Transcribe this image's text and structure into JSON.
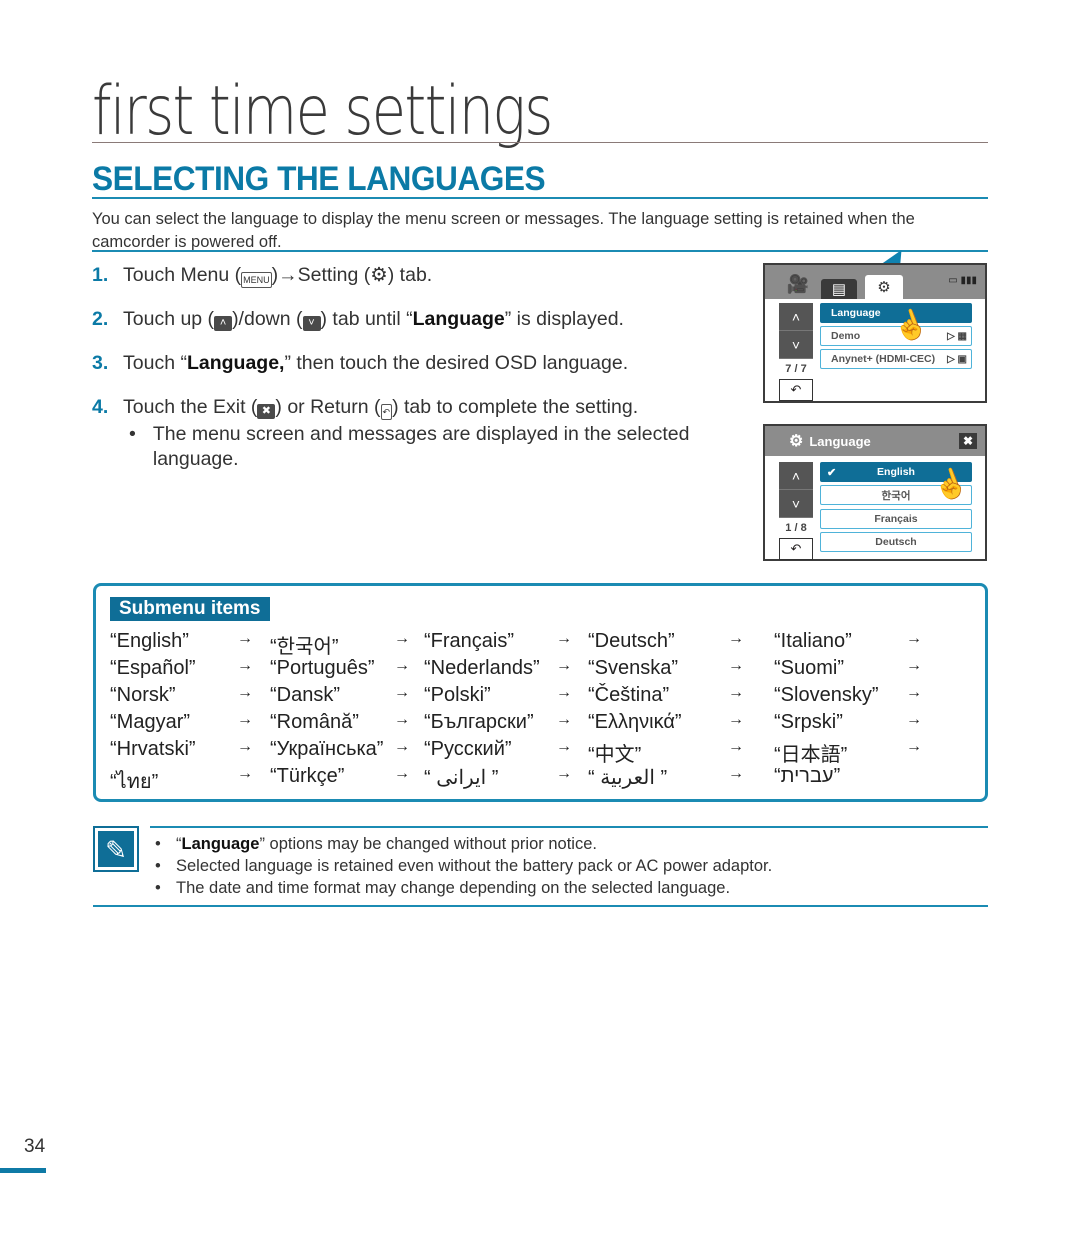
{
  "header": {
    "chapter_title": "first time settings",
    "section_title": "SELECTING THE LANGUAGES",
    "intro": "You can select the language to display the menu screen or messages. The language setting is retained when the camcorder is powered off."
  },
  "steps": [
    {
      "num": "1.",
      "parts": [
        "Touch Menu (",
        "MENU",
        ")→Setting (",
        "⚙",
        ") tab."
      ]
    },
    {
      "num": "2.",
      "parts": [
        "Touch up (",
        "˄",
        ")/down (",
        "˅",
        ") tab until “",
        "Language",
        "” is displayed."
      ]
    },
    {
      "num": "3.",
      "parts": [
        "Touch “",
        "Language,",
        "” then touch the desired OSD language."
      ]
    },
    {
      "num": "4.",
      "parts": [
        "Touch the Exit (",
        "✖",
        ") or Return (",
        "↶",
        ") tab to complete the setting."
      ]
    }
  ],
  "step_bullet": "The menu screen and messages are displayed in the selected language.",
  "screen1": {
    "status": "▭ ▮▮▮",
    "menu_items": [
      {
        "label": "Language",
        "selected": true,
        "right": ""
      },
      {
        "label": "Demo",
        "selected": false,
        "right": "▷ ▦"
      },
      {
        "label": "Anynet+ (HDMI-CEC)",
        "selected": false,
        "right": "▷ ▣"
      }
    ],
    "page_indicator": "7 / 7"
  },
  "screen2": {
    "title": "Language",
    "menu_items": [
      {
        "label": "English",
        "selected": true
      },
      {
        "label": "한국어",
        "selected": false
      },
      {
        "label": "Français",
        "selected": false
      },
      {
        "label": "Deutsch",
        "selected": false
      }
    ],
    "page_indicator": "1 / 8"
  },
  "submenu": {
    "label": "Submenu items",
    "rows": [
      [
        "“English”",
        "“한국어”",
        "“Français”",
        "“Deutsch”",
        "“Italiano”"
      ],
      [
        "“Español”",
        "“Português”",
        "“Nederlands”",
        "“Svenska”",
        "“Suomi”"
      ],
      [
        "“Norsk”",
        "“Dansk”",
        "“Polski”",
        "“Čeština”",
        "“Slovensky”"
      ],
      [
        "“Magyar”",
        "“Română”",
        "“Български”",
        "“Ελληνικά”",
        "“Srpski”"
      ],
      [
        "“Hrvatski”",
        "“Українська”",
        "“Русский”",
        "“中文”",
        "“日本語”"
      ],
      [
        "“ไทย”",
        "“Türkçe”",
        "“ ایرانی ”",
        "“ العربية ”",
        "“עברית”"
      ]
    ],
    "arrow": "→"
  },
  "notes": [
    {
      "bold": "Language",
      "pre": "“",
      "post": "” options may be changed without prior notice."
    },
    {
      "bold": "",
      "pre": "",
      "post": "Selected language is retained even without the battery pack or AC power adaptor."
    },
    {
      "bold": "",
      "pre": "",
      "post": "The date and time format may change depending on the selected language."
    }
  ],
  "page_number": "34"
}
